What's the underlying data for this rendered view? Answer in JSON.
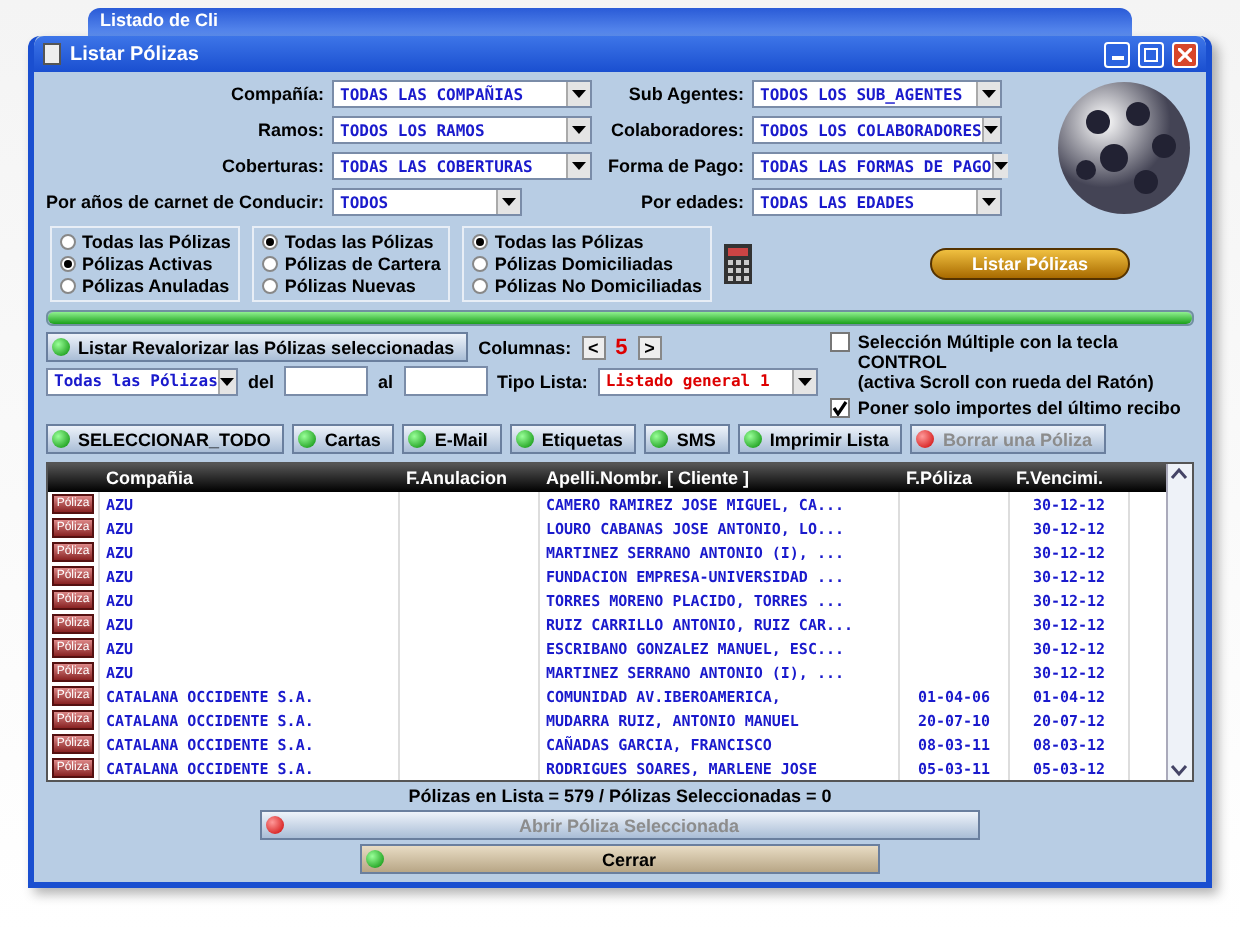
{
  "back_window": {
    "title": "Listado de Cli"
  },
  "window": {
    "title": "Listar Pólizas"
  },
  "filters_left": [
    {
      "label": "Compañía:",
      "value": "TODAS LAS COMPAÑIAS"
    },
    {
      "label": "Ramos:",
      "value": "TODOS LOS RAMOS"
    },
    {
      "label": "Coberturas:",
      "value": "TODAS LAS COBERTURAS"
    },
    {
      "label": "Por años de carnet de Conducir:",
      "value": "TODOS"
    }
  ],
  "filters_right": [
    {
      "label": "Sub Agentes:",
      "value": "TODOS LOS SUB_AGENTES"
    },
    {
      "label": "Colaboradores:",
      "value": "TODOS LOS COLABORADORES"
    },
    {
      "label": "Forma de Pago:",
      "value": "TODAS LAS FORMAS DE PAGO"
    },
    {
      "label": "Por edades:",
      "value": "TODAS LAS EDADES"
    }
  ],
  "radio_groups": [
    [
      {
        "label": "Todas las Pólizas",
        "selected": false
      },
      {
        "label": "Pólizas Activas",
        "selected": true
      },
      {
        "label": "Pólizas Anuladas",
        "selected": false
      }
    ],
    [
      {
        "label": "Todas las Pólizas",
        "selected": true
      },
      {
        "label": "Pólizas de Cartera",
        "selected": false
      },
      {
        "label": "Pólizas Nuevas",
        "selected": false
      }
    ],
    [
      {
        "label": "Todas las Pólizas",
        "selected": true
      },
      {
        "label": "Pólizas Domiciliadas",
        "selected": false
      },
      {
        "label": "Pólizas No Domiciliadas",
        "selected": false
      }
    ]
  ],
  "list_button": "Listar Pólizas",
  "progress": {
    "level": 1
  },
  "revalue_button": {
    "label": "Listar Revalorizar las Pólizas seleccionadas",
    "disabled": false
  },
  "columns": {
    "label": "Columnas:",
    "prev": "<",
    "value": "5",
    "next": ">"
  },
  "checkboxes": [
    {
      "label": "Selección Múltiple con  la tecla CONTROL",
      "note": "(activa Scroll con rueda del Ratón)",
      "checked": false
    },
    {
      "label": "Poner solo importes del último recibo",
      "checked": true
    }
  ],
  "range": {
    "scope": "Todas las Pólizas",
    "from_label": "del",
    "to_label": "al",
    "type_label": "Tipo Lista:",
    "type_value": "Listado general 1"
  },
  "actions": [
    {
      "label": "SELECCIONAR_TODO",
      "disabled": false
    },
    {
      "label": "Cartas",
      "disabled": false
    },
    {
      "label": "E-Mail",
      "disabled": false
    },
    {
      "label": "Etiquetas",
      "disabled": false
    },
    {
      "label": "SMS",
      "disabled": false
    },
    {
      "label": "Imprimir Lista",
      "disabled": false
    },
    {
      "label": "Borrar una Póliza",
      "disabled": true
    }
  ],
  "table": {
    "columns": [
      "Compañia",
      "F.Anulacion",
      "Apelli.Nombr. [ Cliente ]",
      "F.Póliza",
      "F.Vencimi."
    ],
    "rows": [
      {
        "button": "Póliza",
        "company": "AZU",
        "cancelled": "",
        "client": "CAMERO RAMIREZ JOSE MIGUEL, CA...",
        "policy_date": "",
        "due_date": "30-12-12"
      },
      {
        "button": "Póliza",
        "company": "AZU",
        "cancelled": "",
        "client": "LOURO CABANAS JOSE ANTONIO, LO...",
        "policy_date": "",
        "due_date": "30-12-12"
      },
      {
        "button": "Póliza",
        "company": "AZU",
        "cancelled": "",
        "client": "MARTINEZ SERRANO ANTONIO (I), ...",
        "policy_date": "",
        "due_date": "30-12-12"
      },
      {
        "button": "Póliza",
        "company": "AZU",
        "cancelled": "",
        "client": "FUNDACION EMPRESA-UNIVERSIDAD ...",
        "policy_date": "",
        "due_date": "30-12-12"
      },
      {
        "button": "Póliza",
        "company": "AZU",
        "cancelled": "",
        "client": "TORRES MORENO PLACIDO, TORRES ...",
        "policy_date": "",
        "due_date": "30-12-12"
      },
      {
        "button": "Póliza",
        "company": "AZU",
        "cancelled": "",
        "client": "RUIZ CARRILLO ANTONIO, RUIZ CAR...",
        "policy_date": "",
        "due_date": "30-12-12"
      },
      {
        "button": "Póliza",
        "company": "AZU",
        "cancelled": "",
        "client": "ESCRIBANO GONZALEZ MANUEL, ESC...",
        "policy_date": "",
        "due_date": "30-12-12"
      },
      {
        "button": "Póliza",
        "company": "AZU",
        "cancelled": "",
        "client": "MARTINEZ SERRANO ANTONIO (I), ...",
        "policy_date": "",
        "due_date": "30-12-12"
      },
      {
        "button": "Póliza",
        "company": "CATALANA OCCIDENTE S.A.",
        "cancelled": "",
        "client": "COMUNIDAD AV.IBEROAMERICA,",
        "policy_date": "01-04-06",
        "due_date": "01-04-12"
      },
      {
        "button": "Póliza",
        "company": "CATALANA OCCIDENTE S.A.",
        "cancelled": "",
        "client": "MUDARRA RUIZ, ANTONIO MANUEL",
        "policy_date": "20-07-10",
        "due_date": "20-07-12"
      },
      {
        "button": "Póliza",
        "company": "CATALANA OCCIDENTE S.A.",
        "cancelled": "",
        "client": "CAÑADAS GARCIA, FRANCISCO",
        "policy_date": "08-03-11",
        "due_date": "08-03-12"
      },
      {
        "button": "Póliza",
        "company": "CATALANA OCCIDENTE S.A.",
        "cancelled": "",
        "client": "RODRIGUES SOARES, MARLENE JOSE",
        "policy_date": "05-03-11",
        "due_date": "05-03-12"
      }
    ]
  },
  "summary": "Pólizas en Lista = 579  /  Pólizas Seleccionadas = 0",
  "open_button": {
    "label": "Abrir Póliza Seleccionada",
    "disabled": true
  },
  "close_button": {
    "label": "Cerrar",
    "disabled": false
  }
}
